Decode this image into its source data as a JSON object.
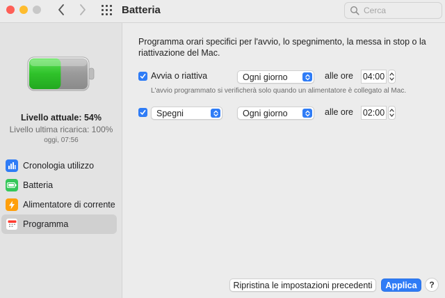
{
  "window": {
    "title": "Batteria",
    "search_placeholder": "Cerca"
  },
  "sidebar": {
    "battery_level_fraction": 0.54,
    "current_level": "Livello attuale: 54%",
    "last_charge": "Livello ultima ricarica: 100%",
    "timestamp": "oggi, 07:56",
    "items": [
      {
        "label": "Cronologia utilizzo",
        "icon": "bar-chart-icon",
        "color": "#2f7cf6"
      },
      {
        "label": "Batteria",
        "icon": "battery-icon",
        "color": "#34c759"
      },
      {
        "label": "Alimentatore di corrente",
        "icon": "lightning-icon",
        "color": "#ff9f0a"
      },
      {
        "label": "Programma",
        "icon": "calendar-icon",
        "color": "#ffffff",
        "selected": true
      }
    ]
  },
  "main": {
    "description": "Programma orari specifici per l'avvio, lo spegnimento, la messa in stop o la riattivazione del Mac.",
    "schedule1": {
      "checked": true,
      "label": "Avvia o riattiva",
      "frequency": "Ogni giorno",
      "at_label": "alle ore",
      "time": "04:00"
    },
    "note": "L'avvio programmato si verificherà solo quando un alimentatore è collegato al Mac.",
    "schedule2": {
      "checked": true,
      "action": "Spegni",
      "frequency": "Ogni giorno",
      "at_label": "alle ore",
      "time": "02:00"
    },
    "buttons": {
      "restore": "Ripristina le impostazioni precedenti",
      "apply": "Applica",
      "help": "?"
    }
  },
  "colors": {
    "accent": "#2f7cf6",
    "battery_green": "#34c759"
  }
}
